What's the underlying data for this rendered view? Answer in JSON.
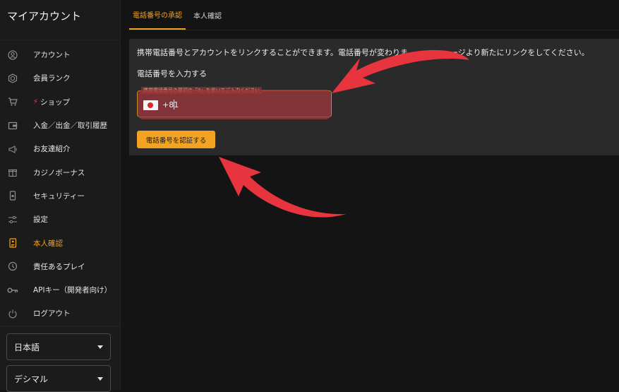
{
  "app": {
    "title": "マイアカウント"
  },
  "sidebar": {
    "items": [
      {
        "label": "アカウント",
        "icon": "account-circle-icon"
      },
      {
        "label": "会員ランク",
        "icon": "rank-hexagon-icon"
      },
      {
        "label": "ショップ",
        "icon": "cart-icon",
        "badge_icon": "lightning-icon"
      },
      {
        "label": "入金／出金／取引履歴",
        "icon": "wallet-icon"
      },
      {
        "label": "お友達紹介",
        "icon": "megaphone-icon"
      },
      {
        "label": "カジノボーナス",
        "icon": "gift-icon"
      },
      {
        "label": "セキュリティー",
        "icon": "phone-lock-icon"
      },
      {
        "label": "設定",
        "icon": "sliders-icon"
      },
      {
        "label": "本人確認",
        "icon": "id-document-icon",
        "active": true
      },
      {
        "label": "責任あるプレイ",
        "icon": "history-icon"
      },
      {
        "label": "APIキー（開発者向け）",
        "icon": "key-icon"
      },
      {
        "label": "ログアウト",
        "icon": "power-icon"
      }
    ],
    "language_select": {
      "value": "日本語"
    },
    "odds_format_select": {
      "value": "デシマル"
    }
  },
  "tabs": [
    {
      "label": "電話番号の承認",
      "active": true
    },
    {
      "label": "本人確認",
      "active": false
    }
  ],
  "panel": {
    "info_text": "携帯電話番号とアカウントをリンクすることができます。電話番号が変わりま",
    "info_text_tail": "ージより新たにリンクをしてください。",
    "section_title": "電話番号を入力する",
    "phone_field": {
      "legend": "携帯電話番号の最初の「0」を省いてご入力ください",
      "country_flag": "japan-flag-icon",
      "prefix": "+81",
      "value": ""
    },
    "verify_button": "電話番号を認証する"
  },
  "colors": {
    "accent": "#f3a321",
    "background": "#141414",
    "sidebar": "#1b1b1b",
    "panel": "#2a2a2a",
    "annotation_arrow": "#e8343e"
  }
}
